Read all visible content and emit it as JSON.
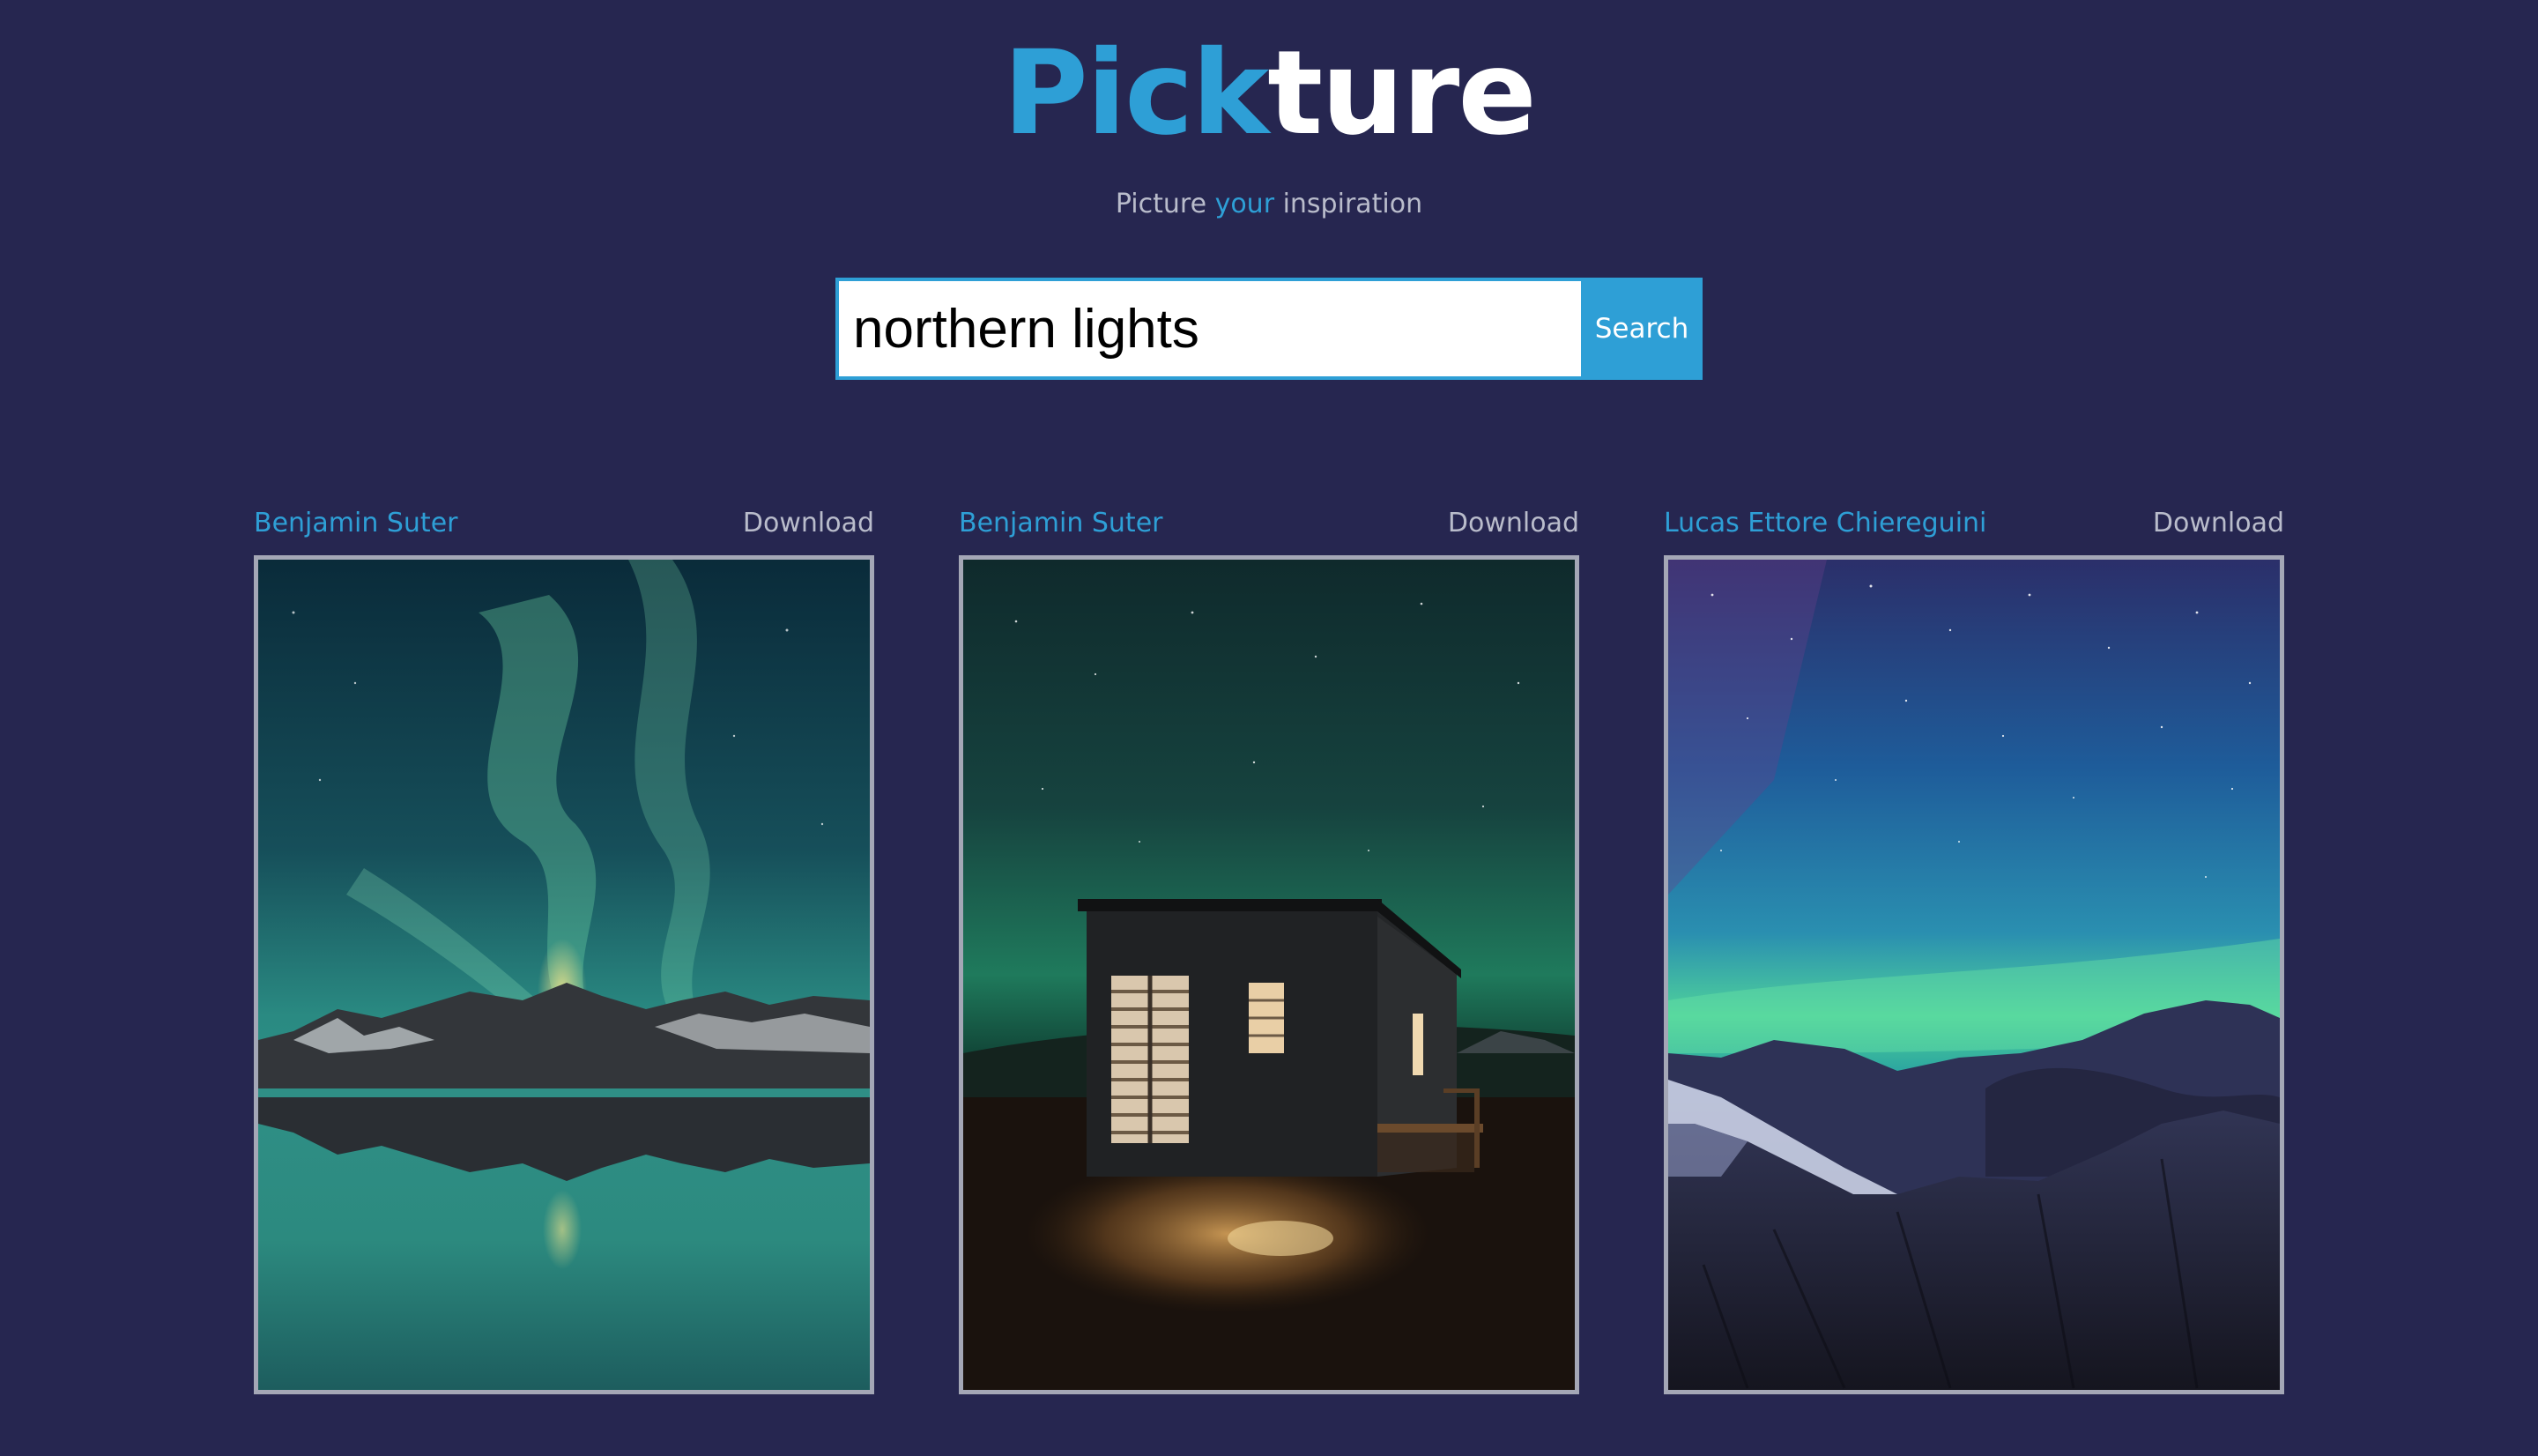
{
  "header": {
    "logo_part1": "Pick",
    "logo_part2": "ture",
    "tagline_before": "Picture ",
    "tagline_highlight": "your",
    "tagline_after": " inspiration"
  },
  "search": {
    "value": "northern lights",
    "button_label": "Search"
  },
  "results": [
    {
      "author": "Benjamin Suter",
      "download_label": "Download",
      "image_subject": "aurora over mountains reflected in lake"
    },
    {
      "author": "Benjamin Suter",
      "download_label": "Download",
      "image_subject": "lit cabin under green aurora"
    },
    {
      "author": "Lucas Ettore Chiereguini",
      "download_label": "Download",
      "image_subject": "aurora over snowy mountain range"
    }
  ],
  "colors": {
    "background": "#262650",
    "accent": "#2e9fd6",
    "text_muted": "#b9bccb",
    "frame_border": "#a4a7b6"
  }
}
